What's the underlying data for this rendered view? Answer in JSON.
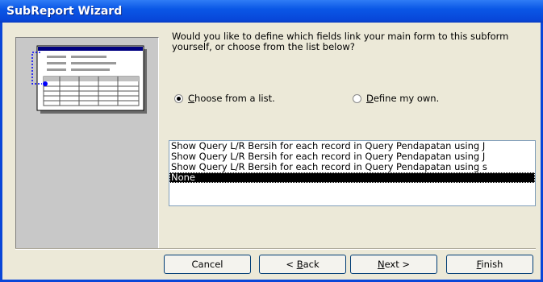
{
  "window": {
    "title": "SubReport Wizard"
  },
  "prompt": "Would you like to define which fields link your main form to this subform yourself, or choose from the list below?",
  "options": [
    {
      "pre": "",
      "key": "C",
      "rest": "hoose from a list.",
      "selected": true
    },
    {
      "pre": "",
      "key": "D",
      "rest": "efine my own.",
      "selected": false
    }
  ],
  "links": {
    "items": [
      "Show Query L/R Bersih for each record in Query Pendapatan using J",
      "Show Query L/R Bersih for each record in Query Pendapatan using J",
      "Show Query L/R Bersih for each record in Query Pendapatan using s",
      "None"
    ],
    "selected_index": 3
  },
  "buttons": {
    "cancel": {
      "pre": "Cancel",
      "key": "",
      "rest": ""
    },
    "back": {
      "pre": "< ",
      "key": "B",
      "rest": "ack"
    },
    "next": {
      "pre": "",
      "key": "N",
      "rest": "ext >"
    },
    "finish": {
      "pre": "",
      "key": "F",
      "rest": "inish"
    }
  },
  "colors": {
    "title_bar": "#0a57e6",
    "selection": "#000000",
    "dialog_bg": "#ece9d8"
  },
  "illustration": {
    "icon": "form-subform-link-diagram-icon"
  }
}
